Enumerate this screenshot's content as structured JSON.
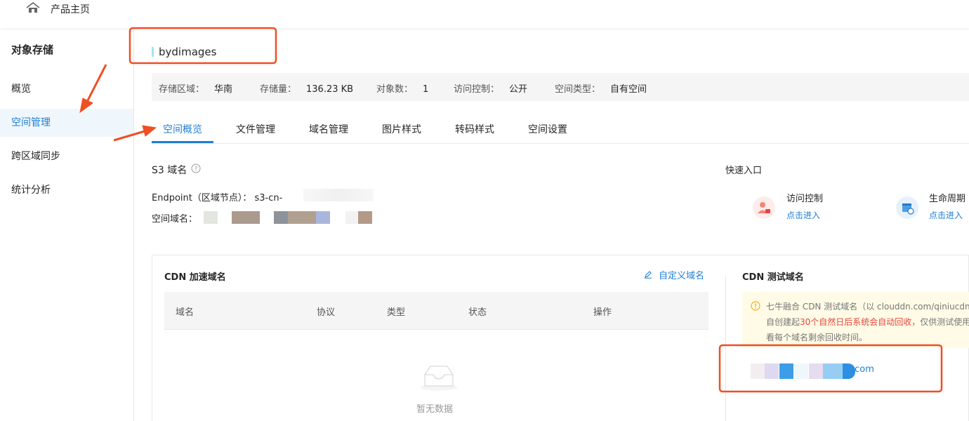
{
  "topbar": {
    "title": "产品主页",
    "icon": "home-icon"
  },
  "sidebar": {
    "title": "对象存储",
    "items": [
      {
        "label": "概览"
      },
      {
        "label": "空间管理",
        "active": true
      },
      {
        "label": "跨区域同步"
      },
      {
        "label": "统计分析"
      }
    ]
  },
  "bucket": {
    "name": "bydimages"
  },
  "info": [
    {
      "label": "存储区域：",
      "value": "华南"
    },
    {
      "label": "存储量：",
      "value": "136.23 KB"
    },
    {
      "label": "对象数：",
      "value": "1"
    },
    {
      "label": "访问控制：",
      "value": "公开"
    },
    {
      "label": "空间类型：",
      "value": "自有空间"
    }
  ],
  "tabs": [
    {
      "label": "空间概览",
      "active": true
    },
    {
      "label": "文件管理"
    },
    {
      "label": "域名管理"
    },
    {
      "label": "图片样式"
    },
    {
      "label": "转码样式"
    },
    {
      "label": "空间设置"
    }
  ],
  "s3": {
    "title": "S3 域名",
    "endpoint_label": "Endpoint（区域节点）：",
    "endpoint_value": "s3-cn-",
    "domain_label": "空间域名："
  },
  "quick": {
    "title": "快速入口",
    "items": [
      {
        "label": "访问控制",
        "link": "点击进入",
        "icon": "access-control-icon",
        "color": "#f2857a"
      },
      {
        "label": "生命周期",
        "link": "点击进入",
        "icon": "lifecycle-icon",
        "color": "#4a9fe8"
      }
    ]
  },
  "cdn": {
    "title": "CDN 加速域名",
    "custom_label": "自定义域名",
    "columns": [
      "域名",
      "协议",
      "类型",
      "状态",
      "操作"
    ],
    "empty_text": "暂无数据",
    "test_title": "CDN 测试域名",
    "notice_line1": "七牛融合 CDN 测试域名（以 clouddn.com/qiniucdn.co",
    "notice_line2_pre": "自创建起",
    "notice_line2_red": "30个自然日后系统会自动回收，",
    "notice_line2_post": "仅供测试使用",
    "notice_line3": "看每个域名剩余回收时间。",
    "test_domain_suffix": ".com"
  },
  "colors": {
    "accent": "#1f7fd4",
    "annotation": "#f04e23",
    "warning": "#faad14"
  }
}
